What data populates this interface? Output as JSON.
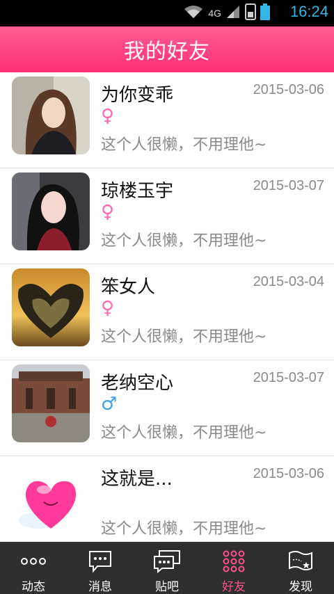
{
  "status_bar": {
    "network_label": "4G",
    "time": "16:24",
    "icons": [
      "wifi-icon",
      "signal-icon",
      "sim-icon",
      "battery-icon"
    ],
    "accent_color": "#33b5e5"
  },
  "header": {
    "title": "我的好友",
    "background_color": "#ff3d7f"
  },
  "friends": [
    {
      "name": "为你变乖",
      "date": "2015-03-06",
      "gender": "female",
      "gender_symbol": "♀",
      "signature": "这个人很懒，不用理他~"
    },
    {
      "name": "琼楼玉宇",
      "date": "2015-03-07",
      "gender": "female",
      "gender_symbol": "♀",
      "signature": "这个人很懒，不用理他~"
    },
    {
      "name": "笨女人",
      "date": "2015-03-04",
      "gender": "female",
      "gender_symbol": "♀",
      "signature": "这个人很懒，不用理他~"
    },
    {
      "name": "老纳空心",
      "date": "2015-03-07",
      "gender": "male",
      "gender_symbol": "♂",
      "signature": "这个人很懒，不用理他~"
    },
    {
      "name": "这就是...",
      "date": "2015-03-06",
      "gender": "none",
      "gender_symbol": "",
      "signature": "这个人很懒，不用理他~"
    }
  ],
  "tabbar": {
    "tabs": [
      {
        "label": "动态",
        "icon": "dots-icon",
        "active": false
      },
      {
        "label": "消息",
        "icon": "message-bubble-icon",
        "active": false
      },
      {
        "label": "贴吧",
        "icon": "chat-bubbles-icon",
        "active": false
      },
      {
        "label": "好友",
        "icon": "dot-grid-icon",
        "active": true
      },
      {
        "label": "发现",
        "icon": "map-flag-icon",
        "active": false
      }
    ],
    "active_color": "#ff4f8f"
  }
}
